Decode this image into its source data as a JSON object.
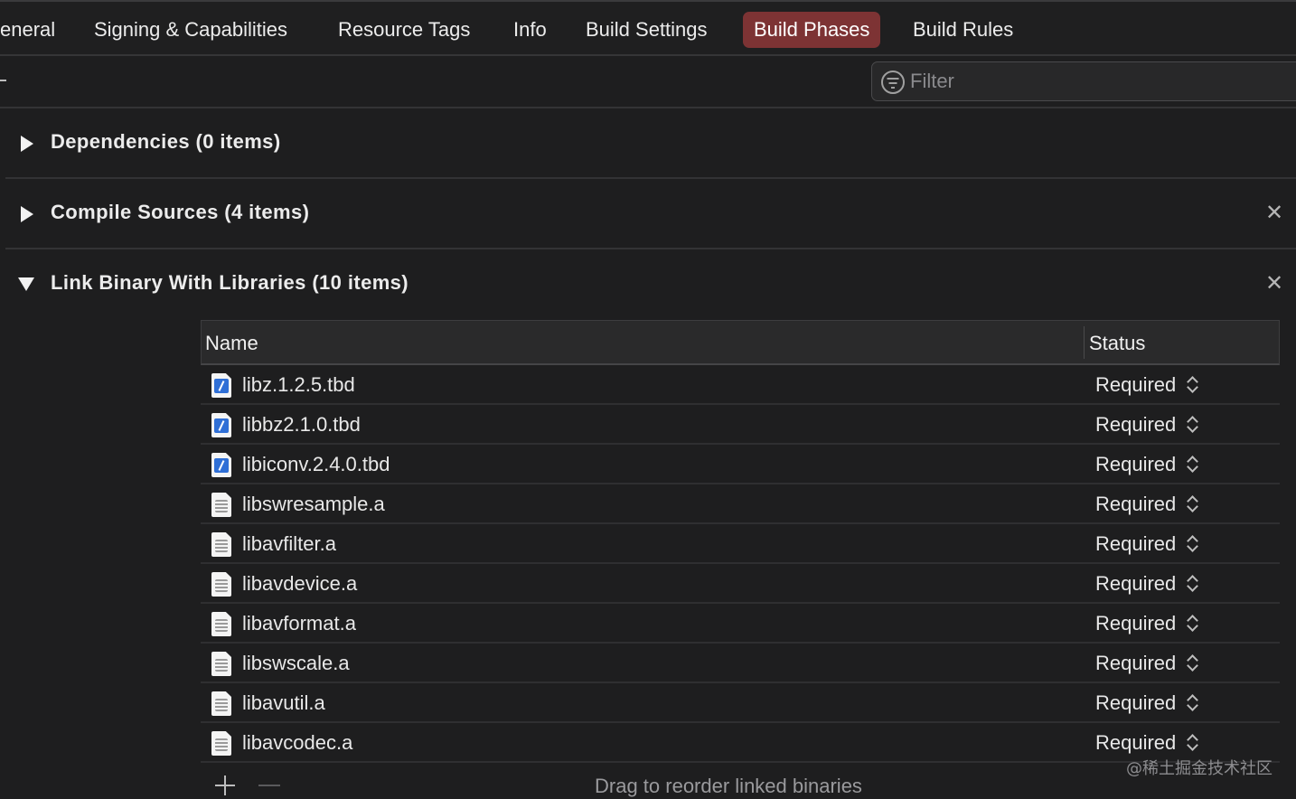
{
  "tabs": [
    {
      "label": "eneral",
      "active": false
    },
    {
      "label": "Signing & Capabilities",
      "active": false
    },
    {
      "label": "Resource Tags",
      "active": false
    },
    {
      "label": "Info",
      "active": false
    },
    {
      "label": "Build Settings",
      "active": false
    },
    {
      "label": "Build Phases",
      "active": true
    },
    {
      "label": "Build Rules",
      "active": false
    }
  ],
  "filter": {
    "placeholder": "Filter",
    "value": ""
  },
  "sections": [
    {
      "title": "Dependencies (0 items)",
      "expanded": false,
      "removable": false
    },
    {
      "title": "Compile Sources (4 items)",
      "expanded": false,
      "removable": true
    },
    {
      "title": "Link Binary With Libraries (10 items)",
      "expanded": true,
      "removable": true
    }
  ],
  "libraries_table": {
    "columns": [
      "Name",
      "Status"
    ],
    "rows": [
      {
        "name": "libz.1.2.5.tbd",
        "status": "Required",
        "icon": "tbd-file-icon"
      },
      {
        "name": "libbz2.1.0.tbd",
        "status": "Required",
        "icon": "tbd-file-icon"
      },
      {
        "name": "libiconv.2.4.0.tbd",
        "status": "Required",
        "icon": "tbd-file-icon"
      },
      {
        "name": "libswresample.a",
        "status": "Required",
        "icon": "static-library-icon"
      },
      {
        "name": "libavfilter.a",
        "status": "Required",
        "icon": "static-library-icon"
      },
      {
        "name": "libavdevice.a",
        "status": "Required",
        "icon": "static-library-icon"
      },
      {
        "name": "libavformat.a",
        "status": "Required",
        "icon": "static-library-icon"
      },
      {
        "name": "libswscale.a",
        "status": "Required",
        "icon": "static-library-icon"
      },
      {
        "name": "libavutil.a",
        "status": "Required",
        "icon": "static-library-icon"
      },
      {
        "name": "libavcodec.a",
        "status": "Required",
        "icon": "static-library-icon"
      }
    ],
    "footer_hint": "Drag to reorder linked binaries"
  },
  "watermark": "@稀土掘金技术社区",
  "colors": {
    "active_tab": "#7d3334",
    "background": "#1e1e1f",
    "tbd_icon": "#2f6fd6"
  }
}
